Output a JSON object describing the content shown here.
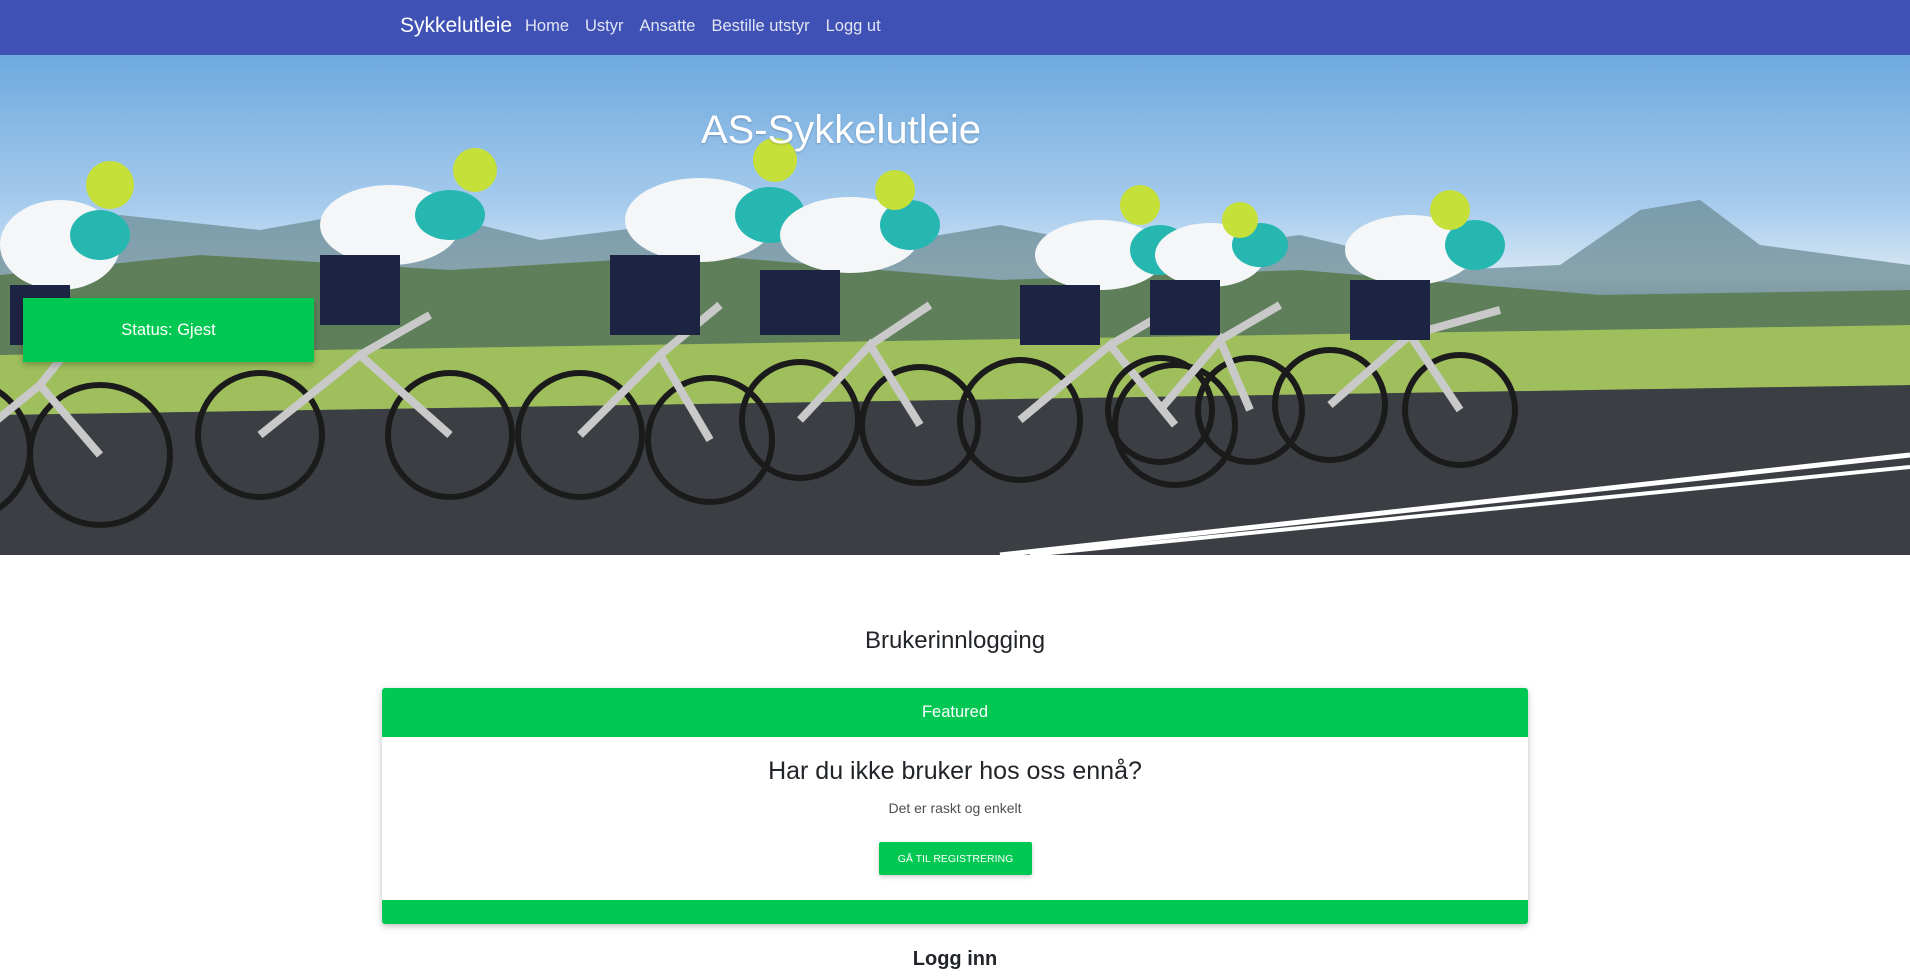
{
  "navbar": {
    "brand": "Sykkelutleie",
    "links": [
      {
        "label": "Home"
      },
      {
        "label": "Ustyr"
      },
      {
        "label": "Ansatte"
      },
      {
        "label": "Bestille utstyr"
      },
      {
        "label": "Logg ut"
      }
    ]
  },
  "hero": {
    "title": "AS-Sykkelutleie",
    "status": "Status: Gjest"
  },
  "main": {
    "heading": "Brukerinnlogging",
    "card": {
      "header": "Featured",
      "title": "Har du ikke bruker hos oss ennå?",
      "text": "Det er raskt og enkelt",
      "button": "Gå til registrering"
    },
    "login_heading": "Logg inn"
  },
  "colors": {
    "navbar": "#3f51b5",
    "accent": "#00c853"
  }
}
